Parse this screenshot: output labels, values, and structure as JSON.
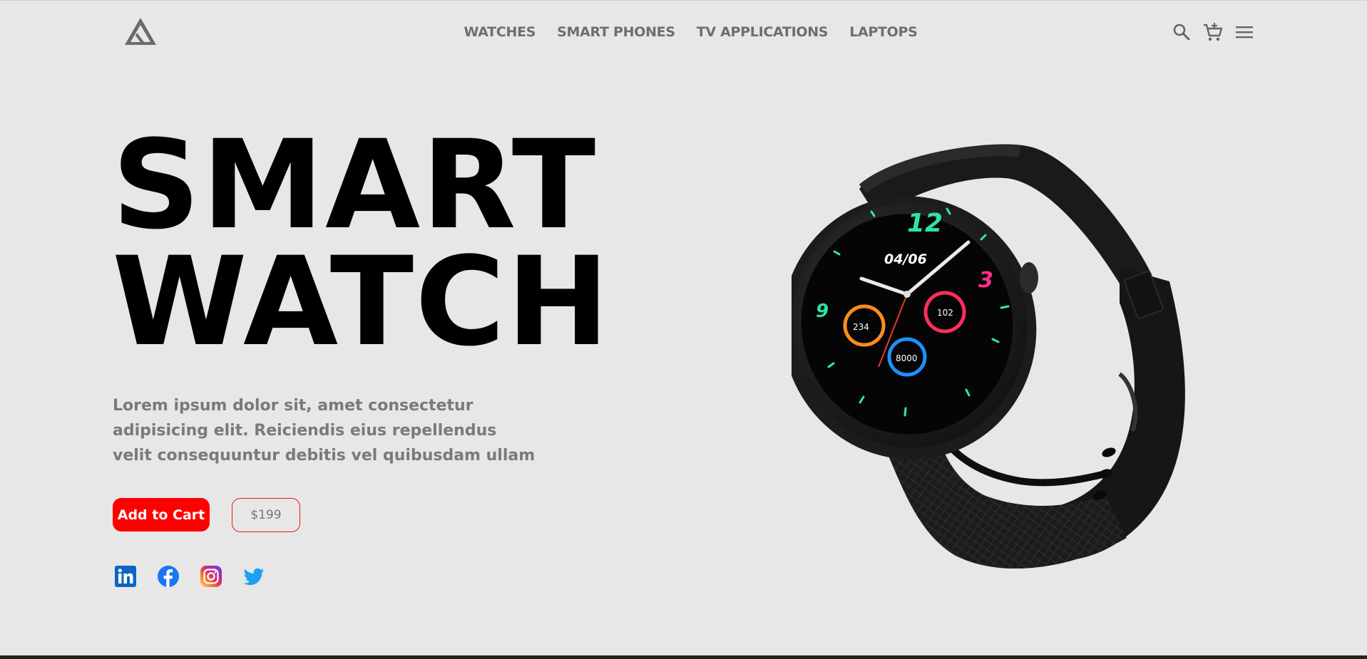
{
  "header": {
    "logo_name": "triangle-logo",
    "nav": [
      {
        "label": "WATCHES"
      },
      {
        "label": "SMART PHONES"
      },
      {
        "label": "TV APPLICATIONS"
      },
      {
        "label": "LAPTOPS"
      }
    ],
    "icons": [
      "search-icon",
      "cart-icon",
      "menu-icon"
    ]
  },
  "hero": {
    "title_line1": "SMART",
    "title_line2": "WATCH",
    "description": "Lorem ipsum dolor sit, amet consectetur adipisicing elit. Reiciendis eius repellendus velit consequuntur debitis vel quibusdam ullam",
    "add_to_cart_label": "Add to Cart",
    "price": "$199"
  },
  "watch_face": {
    "hour_12": "12",
    "hour_3": "3",
    "hour_9": "9",
    "date": "04/06",
    "left_dial": "234",
    "right_dial": "102",
    "bottom_dial": "8000"
  },
  "socials": [
    "linkedin-icon",
    "facebook-icon",
    "instagram-icon",
    "twitter-icon"
  ],
  "colors": {
    "background": "#e7e7e7",
    "accent": "#ff0000",
    "nav_text": "#6e6e6e",
    "body_text": "#7a7a7a"
  }
}
